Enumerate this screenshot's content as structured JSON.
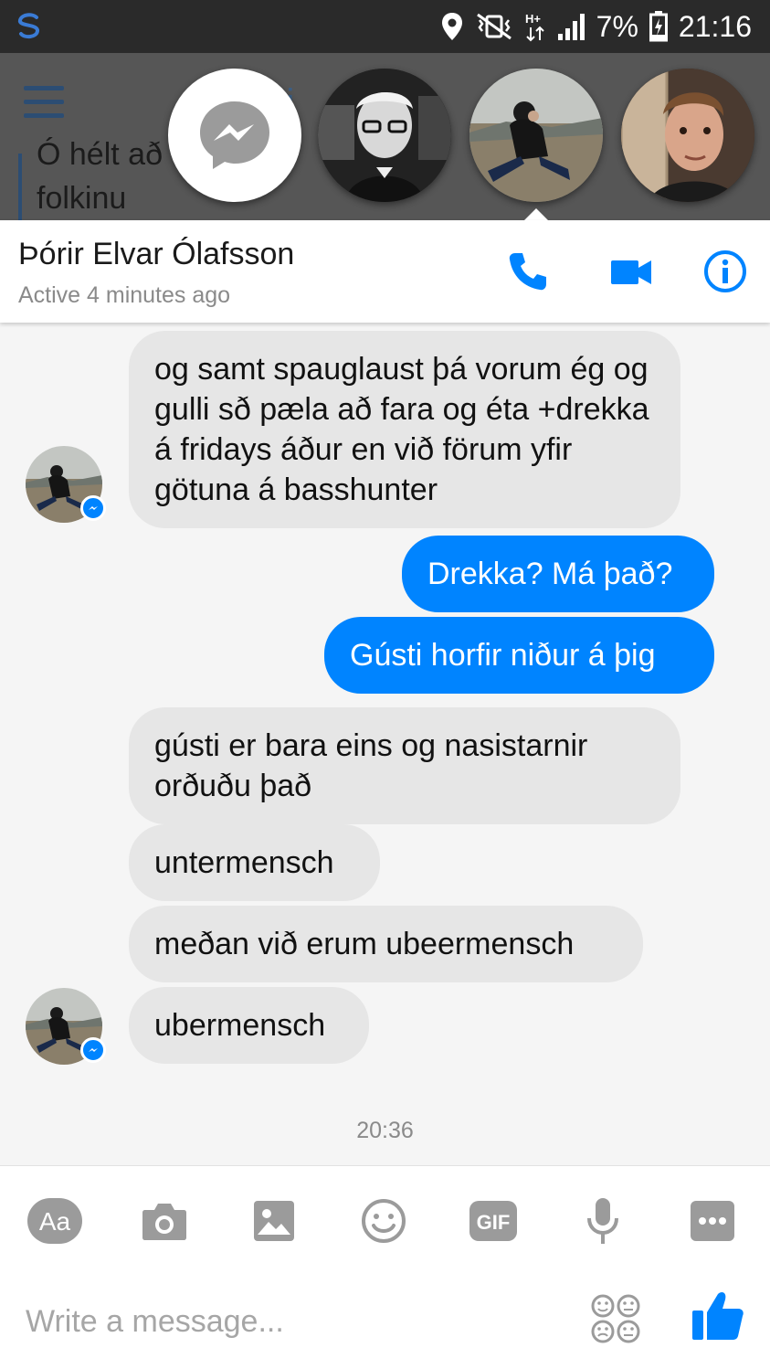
{
  "status_bar": {
    "battery": "7%",
    "time": "21:16"
  },
  "background_app": {
    "title_fragment": "ri",
    "line1": "Ó hélt að",
    "line2": "folkinu"
  },
  "chat_header": {
    "contact_name": "Þórir Elvar Ólafsson",
    "active_status": "Active 4 minutes ago"
  },
  "messages": [
    {
      "direction": "in",
      "text": "og samt spauglaust þá vorum ég og gulli sð pæla að fara og éta +drekka á fridays áður en við förum yfir götuna á basshunter"
    },
    {
      "direction": "out",
      "text": "Drekka? Má það?"
    },
    {
      "direction": "out",
      "text": "Gústi horfir niður á þig"
    },
    {
      "direction": "in",
      "text": "gústi er bara eins og nasistarnir orðuðu það"
    },
    {
      "direction": "in",
      "text": "untermensch"
    },
    {
      "direction": "in",
      "text": "meðan við erum ubeermensch"
    },
    {
      "direction": "in",
      "text": "ubermensch"
    }
  ],
  "timestamp": "20:36",
  "composer": {
    "text_button": "Aa",
    "gif_button": "GIF",
    "placeholder": "Write a message..."
  },
  "colors": {
    "messenger_blue": "#0084ff",
    "incoming_bubble": "#e6e6e6",
    "status_bar": "#2a2a2a"
  }
}
